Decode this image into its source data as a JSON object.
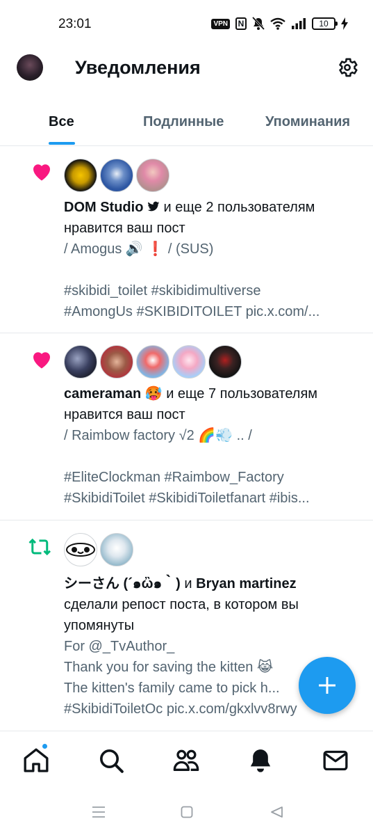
{
  "status_bar": {
    "time": "23:01",
    "vpn": "VPN",
    "nfc": "N",
    "battery": "10"
  },
  "header": {
    "title": "Уведомления",
    "settings_icon": "gear-icon"
  },
  "tabs": [
    {
      "label": "Все",
      "active": true
    },
    {
      "label": "Подлинные",
      "active": false
    },
    {
      "label": "Упоминания",
      "active": false
    }
  ],
  "notifications": [
    {
      "type": "like",
      "icon": "heart-icon",
      "actor": "DOM Studio",
      "actor_badge": "twitter-bird-icon",
      "text": " и еще 2 пользователям нравится ваш пост",
      "preview": [
        "/  Amogus 🔊 ❗ / (SUS)",
        "",
        "#skibidi_toilet #skibidimultiverse",
        "#AmongUs #SKIBIDITOILET pic.x.com/..."
      ]
    },
    {
      "type": "like",
      "icon": "heart-icon",
      "actor": "cameraman 🥵",
      "text": " и еще 7 пользователям нравится ваш пост",
      "preview": [
        "/ Raimbow factory √2 🌈💨 .. /",
        "",
        "#EliteClockman #Raimbow_Factory",
        "#SkibidiToilet #SkibidiToiletfanart #ibis..."
      ]
    },
    {
      "type": "repost",
      "icon": "repost-icon",
      "actor": "シーさん (´๑ὢ๑｀)",
      "conjunction": " и ",
      "actor2": "Bryan martinez",
      "text": "сделали репост поста, в котором вы упомянуты",
      "preview": [
        "For @_TvAuthor_",
        "Thank you for saving the kitten 😹",
        "The kitten's family came to pick h...",
        "#SkibidiToiletOc pic.x.com/gkxlvv8rwy"
      ]
    }
  ],
  "fab": {
    "icon": "plus-icon"
  },
  "bottom_nav": [
    "home-icon",
    "search-icon",
    "communities-icon",
    "notifications-bell-icon",
    "messages-icon"
  ],
  "system_nav": [
    "recents-icon",
    "home-square-icon",
    "back-icon"
  ],
  "colors": {
    "accent": "#1d9bf0",
    "like": "#f91880",
    "repost": "#00ba7c",
    "secondary_text": "#536471"
  }
}
